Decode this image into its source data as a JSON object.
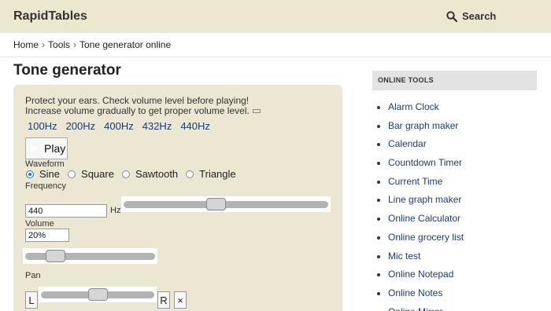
{
  "header": {
    "logo": "RapidTables",
    "search_label": "Search"
  },
  "breadcrumb": [
    "Home",
    "Tools",
    "Tone generator online"
  ],
  "breadcrumb_sep": "›",
  "page_title": "Tone generator",
  "panel": {
    "warning_line1": "Protect your ears. Check volume level before playing!",
    "warning_line2": "Increase volume gradually to get proper volume level.",
    "presets": [
      "100Hz",
      "200Hz",
      "400Hz",
      "432Hz",
      "440Hz"
    ],
    "play_label": "Play",
    "waveform_label": "Waveform",
    "waveforms": [
      "Sine",
      "Square",
      "Sawtooth",
      "Triangle"
    ],
    "selected_waveform": "Sine",
    "frequency_label": "Frequency",
    "frequency_value": "440",
    "frequency_unit": "Hz",
    "volume_label": "Volume",
    "volume_value": "20%",
    "pan_label": "Pan",
    "pan_left": "L",
    "pan_right": "R",
    "pan_reset": "×",
    "frequency_slider_level": 0.45,
    "volume_slider_level": 0.2,
    "pan_slider_level": 0.5
  },
  "sidebar": {
    "heading": "ONLINE TOOLS",
    "items": [
      "Alarm Clock",
      "Bar graph maker",
      "Calendar",
      "Countdown Timer",
      "Current Time",
      "Line graph maker",
      "Online Calculator",
      "Online grocery list",
      "Mic test",
      "Online Notepad",
      "Online Notes",
      "Online Mirror"
    ]
  },
  "colors": {
    "header_bg": "#ece8cf",
    "panel_bg": "#ebe7d3",
    "link": "#1f3a6d",
    "radio_accent": "#1a73e8"
  }
}
